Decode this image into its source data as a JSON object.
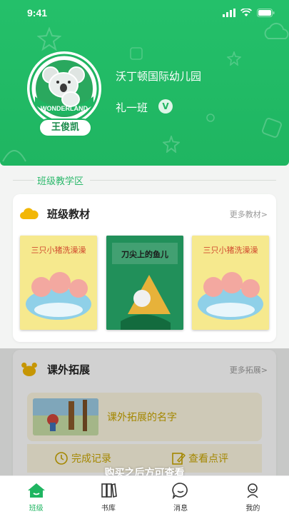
{
  "status_bar": {
    "time": "9:41"
  },
  "profile": {
    "logo_text": "WONDERLAND",
    "student_name": "王俊凯",
    "school": "沃丁顿国际幼儿园",
    "class_name": "礼一班",
    "verified_badge": "V"
  },
  "section": {
    "title": "班级教学区"
  },
  "materials": {
    "title": "班级教材",
    "more": "更多教材>",
    "books": [
      {
        "title": "三只小猪洗澡澡",
        "cover_color": "#f5e88a"
      },
      {
        "title": "刀尖上的鱼儿",
        "cover_color": "#1f8e54"
      },
      {
        "title": "三只小猪洗澡澡",
        "cover_color": "#f5e88a"
      }
    ]
  },
  "extension": {
    "title": "课外拓展",
    "more": "更多拓展>",
    "item_name": "课外拓展的名字",
    "complete_record": "完成记录",
    "view_comments": "查看点评",
    "purchase_tip": "购买之后方可查看"
  },
  "tabbar": {
    "tabs": [
      {
        "label": "班级",
        "icon": "home-icon",
        "active": true
      },
      {
        "label": "书库",
        "icon": "bookshelf-icon",
        "active": false
      },
      {
        "label": "消息",
        "icon": "message-icon",
        "active": false
      },
      {
        "label": "我的",
        "icon": "profile-icon",
        "active": false
      }
    ]
  },
  "colors": {
    "brand_green": "#1fb561",
    "accent_yellow": "#c8a500"
  }
}
